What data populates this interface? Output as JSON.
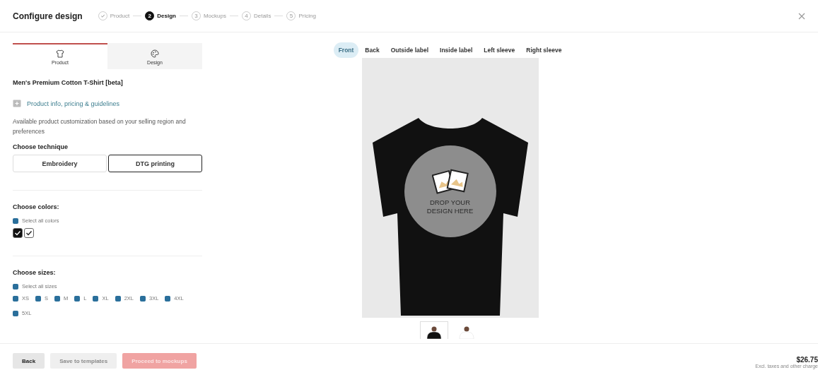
{
  "header": {
    "title": "Configure design",
    "steps": [
      {
        "label": "Product",
        "completed": true,
        "selected": false
      },
      {
        "number": "2",
        "label": "Design",
        "completed": false,
        "selected": true
      },
      {
        "number": "3",
        "label": "Mockups",
        "completed": false,
        "selected": false
      },
      {
        "number": "4",
        "label": "Details",
        "completed": false,
        "selected": false
      },
      {
        "number": "5",
        "label": "Pricing",
        "completed": false,
        "selected": false
      }
    ]
  },
  "panel_tabs": [
    {
      "label": "Product",
      "kind": "shirt",
      "selected": true
    },
    {
      "label": "Design",
      "kind": "palette",
      "selected": false
    }
  ],
  "product": {
    "title": "Men's Premium Cotton T-Shirt [beta]",
    "info_link": "Product info, pricing & guidelines",
    "description": "Available product customization based on your selling region and preferences"
  },
  "technique": {
    "label": "Choose technique",
    "options": [
      {
        "label": "Embroidery",
        "selected": false
      },
      {
        "label": "DTG printing",
        "selected": true
      }
    ]
  },
  "colors": {
    "label": "Choose colors:",
    "select_all": {
      "label": "Select all colors",
      "checked": true
    },
    "swatches": [
      {
        "color": "#111111",
        "checked": true
      },
      {
        "color": "#ffffff",
        "checked": true
      }
    ]
  },
  "sizes": {
    "label": "Choose sizes:",
    "select_all": {
      "label": "Select all sizes",
      "checked": true
    },
    "items": [
      {
        "label": "XS",
        "checked": true
      },
      {
        "label": "S",
        "checked": true
      },
      {
        "label": "M",
        "checked": true
      },
      {
        "label": "L",
        "checked": true
      },
      {
        "label": "XL",
        "checked": true
      },
      {
        "label": "2XL",
        "checked": true
      },
      {
        "label": "3XL",
        "checked": true
      },
      {
        "label": "4XL",
        "checked": true
      },
      {
        "label": "5XL",
        "checked": true
      }
    ]
  },
  "view_tabs": [
    {
      "label": "Front",
      "selected": true
    },
    {
      "label": "Back",
      "selected": false
    },
    {
      "label": "Outside label",
      "selected": false
    },
    {
      "label": "Inside label",
      "selected": false
    },
    {
      "label": "Left sleeve",
      "selected": false
    },
    {
      "label": "Right sleeve",
      "selected": false
    }
  ],
  "drop_zone": {
    "text": "DROP YOUR DESIGN HERE"
  },
  "thumbnails": [
    {
      "color": "#111111",
      "selected": true
    },
    {
      "color": "#ffffff",
      "selected": false
    }
  ],
  "footer": {
    "buttons": [
      {
        "label": "Back",
        "kind": "secondary",
        "disabled": false
      },
      {
        "label": "Save to templates",
        "kind": "secondary",
        "disabled": true
      },
      {
        "label": "Proceed to mockups",
        "kind": "primary",
        "disabled": true
      }
    ],
    "price": "$26.75",
    "price_note": "Excl. taxes and other charge"
  }
}
